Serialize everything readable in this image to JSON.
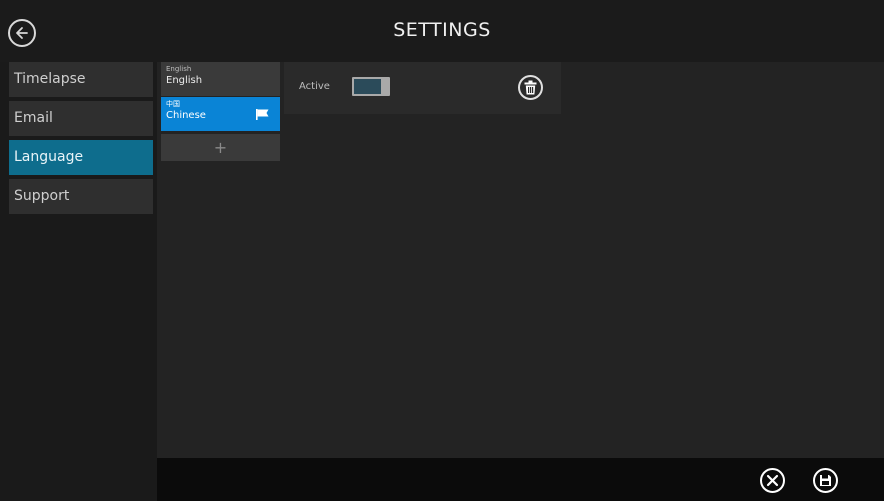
{
  "header": {
    "title": "SETTINGS",
    "back_icon": "back-arrow-circle-icon"
  },
  "sidebar": {
    "items": [
      {
        "label": "Timelapse",
        "active": false
      },
      {
        "label": "Email",
        "active": false
      },
      {
        "label": "Language",
        "active": true
      },
      {
        "label": "Support",
        "active": false
      }
    ]
  },
  "languages": {
    "items": [
      {
        "native": "English",
        "name": "English",
        "selected": false
      },
      {
        "native": "中国",
        "name": "Chinese",
        "selected": true
      }
    ],
    "add_label": "+",
    "flag_icon": "flag-icon"
  },
  "detail": {
    "active_label": "Active",
    "active_toggle_on": false,
    "delete_icon": "trash-icon"
  },
  "footer": {
    "cancel_icon": "close-circle-icon",
    "save_icon": "floppy-save-icon"
  },
  "colors": {
    "accent_nav": "#0e6d8d",
    "accent_selected": "#0a84d6",
    "panel": "#232323"
  }
}
